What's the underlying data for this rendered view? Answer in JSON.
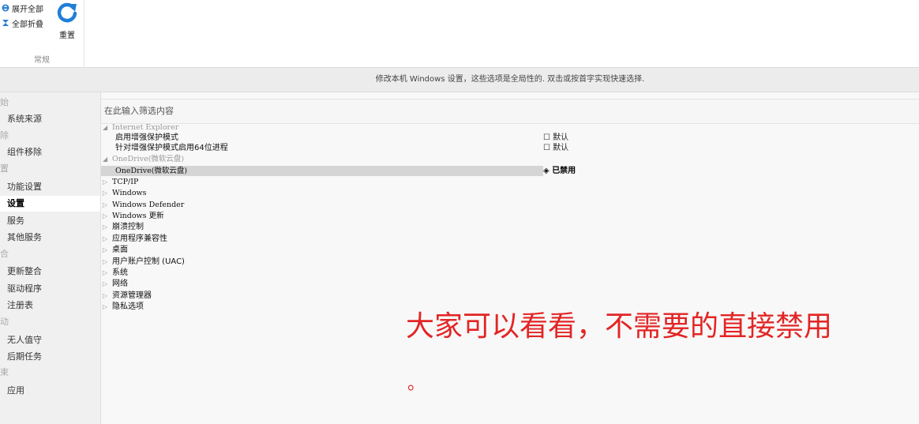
{
  "ribbon": {
    "expand_all": "展开全部",
    "collapse_all": "全部折叠",
    "reset": "重置",
    "group_caption": "常规"
  },
  "description": "修改本机 Windows 设置，这些选项是全局性的. 双击或按首字实现快速选择.",
  "sidebar": {
    "sections": [
      {
        "head": "始",
        "items": [
          "系统来源"
        ]
      },
      {
        "head": "除",
        "items": [
          "组件移除"
        ]
      },
      {
        "head": "置",
        "items": [
          "功能设置",
          "设置",
          "服务",
          "其他服务"
        ]
      },
      {
        "head": "合",
        "items": [
          "更新整合",
          "驱动程序",
          "注册表"
        ]
      },
      {
        "head": "动",
        "items": [
          "无人值守",
          "后期任务"
        ]
      },
      {
        "head": "束",
        "items": [
          "应用"
        ]
      }
    ],
    "active": "设置"
  },
  "filter": {
    "placeholder": "在此输入筛选内容"
  },
  "tree": [
    {
      "label": "Internet Explorer",
      "expanded": true,
      "group": true
    },
    {
      "label": "启用增强保护模式",
      "value": "默认",
      "value_icon": "checkbox-icon"
    },
    {
      "label": "针对增强保护模式启用64位进程",
      "value": "默认",
      "value_icon": "checkbox-icon"
    },
    {
      "label": "OneDrive(微软云盘)",
      "expanded": true,
      "group": true
    },
    {
      "label": "OneDrive(微软云盘)",
      "value": "已禁用",
      "value_icon": "diamond-icon",
      "selected": true
    },
    {
      "label": "TCP/IP",
      "group": true
    },
    {
      "label": "Windows",
      "group": true
    },
    {
      "label": "Windows Defender",
      "group": true
    },
    {
      "label": "Windows 更新",
      "group": true
    },
    {
      "label": "崩溃控制",
      "group": true
    },
    {
      "label": "应用程序兼容性",
      "group": true
    },
    {
      "label": "桌面",
      "group": true
    },
    {
      "label": "用户账户控制 (UAC)",
      "group": true
    },
    {
      "label": "系统",
      "group": true
    },
    {
      "label": "网络",
      "group": true
    },
    {
      "label": "资源管理器",
      "group": true
    },
    {
      "label": "隐私选项",
      "group": true
    }
  ],
  "overlay": {
    "line1": "大家可以看看，不需要的直接禁用",
    "line2": "。",
    "color": "#e32525"
  }
}
